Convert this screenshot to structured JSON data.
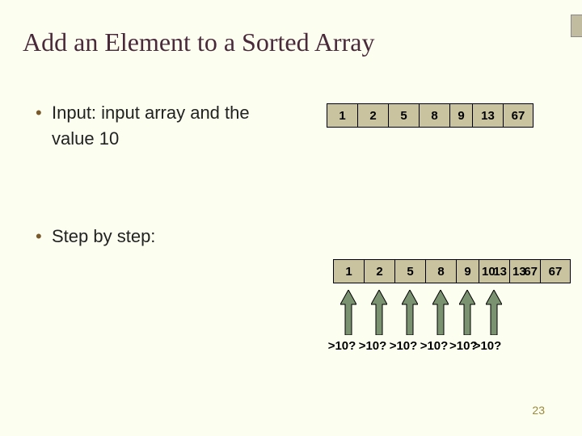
{
  "title": "Add an Element to a Sorted Array",
  "bullets": {
    "b1_line1": "Input: input array and the",
    "b1_line2": "value 10",
    "b2": "Step by step:"
  },
  "array1": [
    "1",
    "2",
    "5",
    "8",
    "9",
    "13",
    "67"
  ],
  "array2": {
    "c0": "1",
    "c1": "2",
    "c2": "5",
    "c3": "8",
    "c4": "9",
    "c5a": "10",
    "c5b": "13",
    "c6a": "13",
    "c6b": "67",
    "c7": "67"
  },
  "gt_label": ">10?",
  "page_number": "23",
  "colors": {
    "bg": "#fcfef0",
    "cell": "#c9c49f",
    "arrow_fill": "#7a926f",
    "arrow_stroke": "#000000",
    "title": "#4a2a3a"
  },
  "chart_data": {
    "type": "table",
    "title": "Add an Element to a Sorted Array",
    "input_value": 10,
    "input_array": [
      1,
      2,
      5,
      8,
      9,
      13,
      67
    ],
    "step_array_before_overwrite": [
      1,
      2,
      5,
      8,
      9,
      13,
      67,
      67
    ],
    "step_array_after_overwrite": [
      1,
      2,
      5,
      8,
      9,
      10,
      13,
      67
    ],
    "comparison_label": ">10?",
    "comparison_positions": [
      0,
      1,
      2,
      3,
      4,
      5
    ]
  }
}
